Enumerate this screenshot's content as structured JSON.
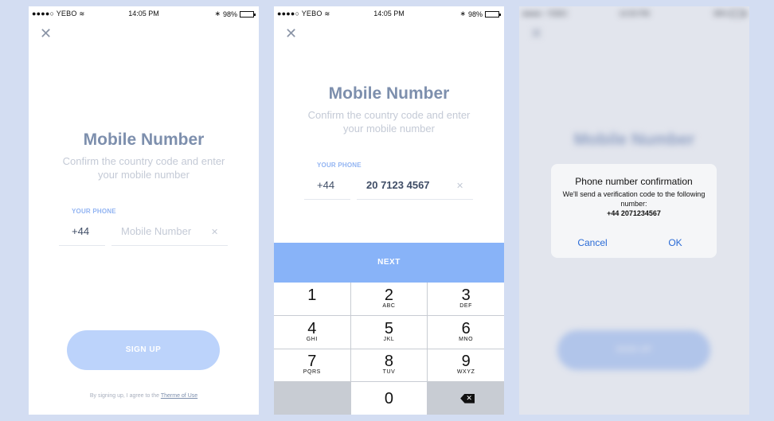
{
  "status": {
    "carrier": "●●●●○ YEBO",
    "time": "14:05 PM",
    "bluetooth": "∗",
    "battery": "98%"
  },
  "screen1": {
    "title": "Mobile Number",
    "subtitle": "Confirm the country code and enter your mobile number",
    "phone_label": "YOUR PHONE",
    "country_code": "+44",
    "number_placeholder": "Mobile Number",
    "signup_label": "SIGN UP",
    "terms_prefix": "By signing up, I agree to the ",
    "terms_link": "Therme of Use"
  },
  "screen2": {
    "title": "Mobile Number",
    "subtitle": "Confirm the country code and enter your mobile number",
    "phone_label": "YOUR PHONE",
    "country_code": "+44",
    "number_value": "20 7123 4567",
    "next_label": "NEXT",
    "keys": [
      {
        "digit": "1",
        "letters": ""
      },
      {
        "digit": "2",
        "letters": "ABC"
      },
      {
        "digit": "3",
        "letters": "DEF"
      },
      {
        "digit": "4",
        "letters": "GHI"
      },
      {
        "digit": "5",
        "letters": "JKL"
      },
      {
        "digit": "6",
        "letters": "MNO"
      },
      {
        "digit": "7",
        "letters": "PQRS"
      },
      {
        "digit": "8",
        "letters": "TUV"
      },
      {
        "digit": "9",
        "letters": "WXYZ"
      },
      {
        "digit": "0",
        "letters": ""
      }
    ]
  },
  "screen3": {
    "background_title": "Mobile Number",
    "background_signup": "SIGN UP",
    "dialog": {
      "title": "Phone number confirmation",
      "message": "We'll send a verification code to the following number:",
      "number": "+44 2071234567",
      "cancel": "Cancel",
      "ok": "OK"
    }
  },
  "colors": {
    "background": "#d3ddf2",
    "title": "#7d8fad",
    "accent": "#88b3f8",
    "button_disabled": "#bcd3fb",
    "dialog_button": "#2a6bd6"
  }
}
